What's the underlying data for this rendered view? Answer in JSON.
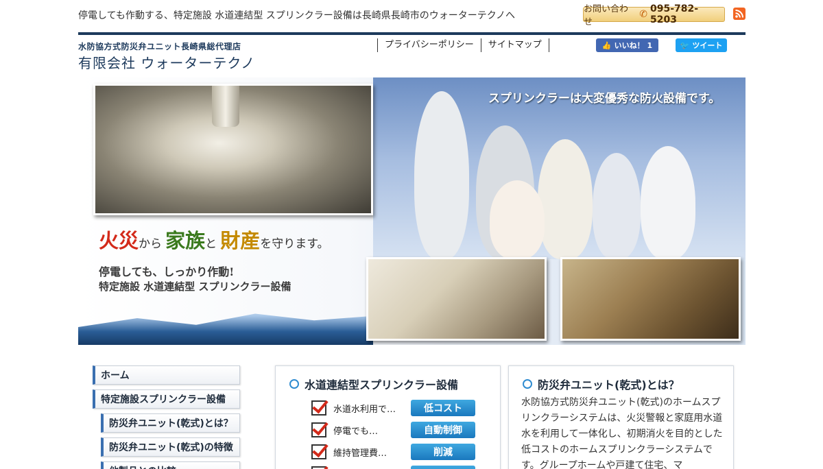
{
  "topbar": {
    "tagline": "停電しても作動する、特定施設 水道連結型 スプリンクラー設備は長崎県長崎市のウォーターテクノへ",
    "contact_label": "お問い合わせ",
    "phone": "095-782-5203"
  },
  "header": {
    "subtitle": "水防協方式防災弁ユニット長崎県総代理店",
    "company": "有限会社 ウォーターテクノ",
    "nav": [
      "プライバシーポリシー",
      "サイトマップ"
    ],
    "fb_like": "いいね！ 1",
    "tweet": "ツイート"
  },
  "hero": {
    "caption": "スプリンクラーは大変優秀な防火設備です。",
    "slogan": {
      "w1": "火災",
      "p1": "から",
      "w2": "家族",
      "p2": "と",
      "w3": "財産",
      "p3": "を守ります。"
    },
    "line2": "停電しても、しっかり作動!",
    "line3": "特定施設 水道連結型 スプリンクラー設備"
  },
  "sidebar": {
    "items": [
      {
        "label": "ホーム"
      },
      {
        "label": "特定施設スプリンクラー設備"
      },
      {
        "label": "防災弁ユニット(乾式)とは？"
      },
      {
        "label": "防災弁ユニット(乾式)の特徴"
      },
      {
        "label": "他製品との比較"
      }
    ]
  },
  "panel_mid": {
    "title": "水道連結型スプリンクラー設備",
    "features": [
      {
        "label": "水道水利用で…",
        "badge": "低コスト"
      },
      {
        "label": "停電でも…",
        "badge": "自動制御"
      },
      {
        "label": "維持管理費…",
        "badge": "削減"
      },
      {
        "label": "",
        "badge": ""
      }
    ]
  },
  "panel_right": {
    "title": "防災弁ユニット(乾式)とは？",
    "body": "水防協方式防災弁ユニット(乾式)のホームスプリンクラーシステムは、火災警報と家庭用水道水を利用して一体化し、初期消火を目的とした低コストのホームスプリンクラーシステムです。グループホームや戸建て住宅、マ"
  },
  "colors": {
    "navy": "#1d3a5c",
    "accent_blue": "#1a78be",
    "red": "#d32a1a"
  }
}
